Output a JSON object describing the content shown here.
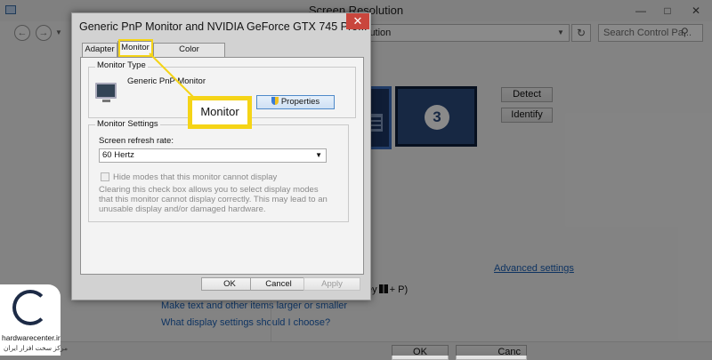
{
  "background_window": {
    "title": "Screen Resolution",
    "address_text": "lution",
    "search_placeholder": "Search Control Pa...",
    "detect_label": "Detect",
    "identify_label": "Identify",
    "monitor_number": "3",
    "advanced_settings": "Advanced settings",
    "shortcut_hint_prefix": "ey",
    "shortcut_hint_suffix": "+ P)",
    "link_text_size": "Make text and other items larger or smaller",
    "link_choose": "What display settings should I choose?",
    "ok_label": "OK",
    "cancel_label": "Canc"
  },
  "dialog": {
    "title": "Generic PnP Monitor and NVIDIA GeForce GTX 745 Pro...",
    "tabs": [
      {
        "label": "Adapter"
      },
      {
        "label": "Monitor"
      },
      {
        "label": "Color Management"
      }
    ],
    "monitor_type_group": "Monitor Type",
    "monitor_name": "Generic PnP Monitor",
    "properties_label": "Properties",
    "monitor_settings_group": "Monitor Settings",
    "refresh_rate_label": "Screen refresh rate:",
    "refresh_rate_value": "60 Hertz",
    "hide_modes_label": "Hide modes that this monitor cannot display",
    "hide_modes_checked": false,
    "description": "Clearing this check box allows you to select display modes that this monitor cannot display correctly. This may lead to an unusable display and/or damaged hardware.",
    "ok_label": "OK",
    "cancel_label": "Cancel",
    "apply_label": "Apply"
  },
  "callout": {
    "text": "Monitor",
    "color": "#f5d417"
  },
  "watermark": {
    "line1": "hardwarecenter.ir",
    "line2": "مرکز سخت افزار ایران"
  }
}
